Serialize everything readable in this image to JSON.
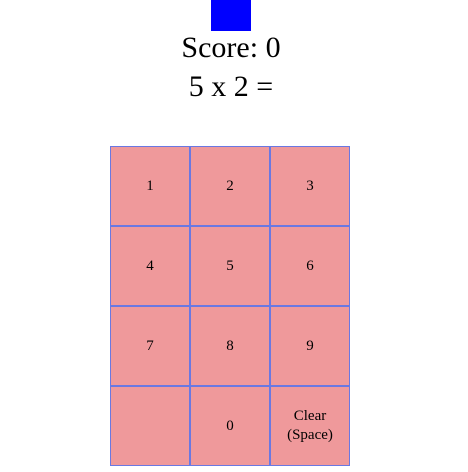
{
  "colors": {
    "indicator": "#0000ff",
    "key_fill": "#ef999b",
    "key_border": "#6a78e2"
  },
  "header": {
    "score_text": "Score: 0",
    "question_text": "5 x 2 ="
  },
  "keypad": {
    "keys": [
      {
        "name": "key-1",
        "label": "1",
        "interactable": true
      },
      {
        "name": "key-2",
        "label": "2",
        "interactable": true
      },
      {
        "name": "key-3",
        "label": "3",
        "interactable": true
      },
      {
        "name": "key-4",
        "label": "4",
        "interactable": true
      },
      {
        "name": "key-5",
        "label": "5",
        "interactable": true
      },
      {
        "name": "key-6",
        "label": "6",
        "interactable": true
      },
      {
        "name": "key-7",
        "label": "7",
        "interactable": true
      },
      {
        "name": "key-8",
        "label": "8",
        "interactable": true
      },
      {
        "name": "key-9",
        "label": "9",
        "interactable": true
      },
      {
        "name": "key-blank",
        "label": "",
        "interactable": false
      },
      {
        "name": "key-0",
        "label": "0",
        "interactable": true
      },
      {
        "name": "clear-button",
        "label": "Clear\n(Space)",
        "interactable": true
      }
    ]
  }
}
